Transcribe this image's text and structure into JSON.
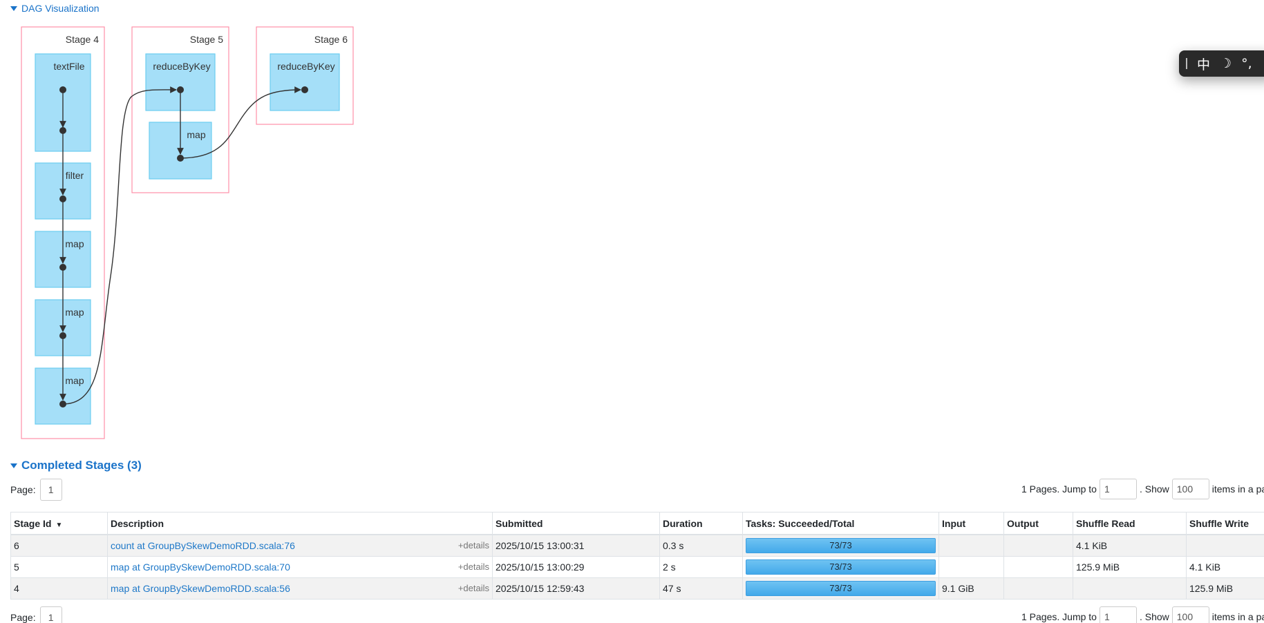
{
  "dag": {
    "toggle_label": "DAG Visualization",
    "stages": [
      {
        "label": "Stage 4",
        "ops": [
          "textFile",
          "filter",
          "map",
          "map",
          "map"
        ]
      },
      {
        "label": "Stage 5",
        "ops": [
          "reduceByKey",
          "map"
        ]
      },
      {
        "label": "Stage 6",
        "ops": [
          "reduceByKey"
        ]
      }
    ],
    "colors": {
      "stage_border": "#ff8fa8",
      "op_fill": "#a5dff8",
      "op_border": "#6ccdf0"
    }
  },
  "ime": {
    "chars": [
      "中",
      "☽",
      "°,"
    ]
  },
  "completed": {
    "title": "Completed Stages (3)",
    "pager_top": {
      "page_label": "Page:",
      "page_value": "1",
      "pages_text": "1 Pages. Jump to",
      "jump_value": "1",
      "show_text": ". Show",
      "show_value": "100",
      "items_text": "items in a page. Go"
    },
    "pager_bottom": {
      "page_label": "Page:",
      "page_value": "1",
      "pages_text": "1 Pages. Jump to",
      "jump_value": "1",
      "show_text": ". Show",
      "show_value": "100",
      "items_text": "items in a page. Go"
    },
    "columns": [
      "Stage Id",
      "Description",
      "Submitted",
      "Duration",
      "Tasks: Succeeded/Total",
      "Input",
      "Output",
      "Shuffle Read",
      "Shuffle Write"
    ],
    "sort_indicator": "▼",
    "details_label": "+details",
    "rows": [
      {
        "id": "6",
        "description": "count at GroupBySkewDemoRDD.scala:76",
        "submitted": "2025/10/15 13:00:31",
        "duration": "0.3 s",
        "tasks": "73/73",
        "input": "",
        "output": "",
        "shuffle_read": "4.1 KiB",
        "shuffle_write": ""
      },
      {
        "id": "5",
        "description": "map at GroupBySkewDemoRDD.scala:70",
        "submitted": "2025/10/15 13:00:29",
        "duration": "2 s",
        "tasks": "73/73",
        "input": "",
        "output": "",
        "shuffle_read": "125.9 MiB",
        "shuffle_write": "4.1 KiB"
      },
      {
        "id": "4",
        "description": "map at GroupBySkewDemoRDD.scala:56",
        "submitted": "2025/10/15 12:59:43",
        "duration": "47 s",
        "tasks": "73/73",
        "input": "9.1 GiB",
        "output": "",
        "shuffle_read": "",
        "shuffle_write": "125.9 MiB"
      }
    ]
  }
}
